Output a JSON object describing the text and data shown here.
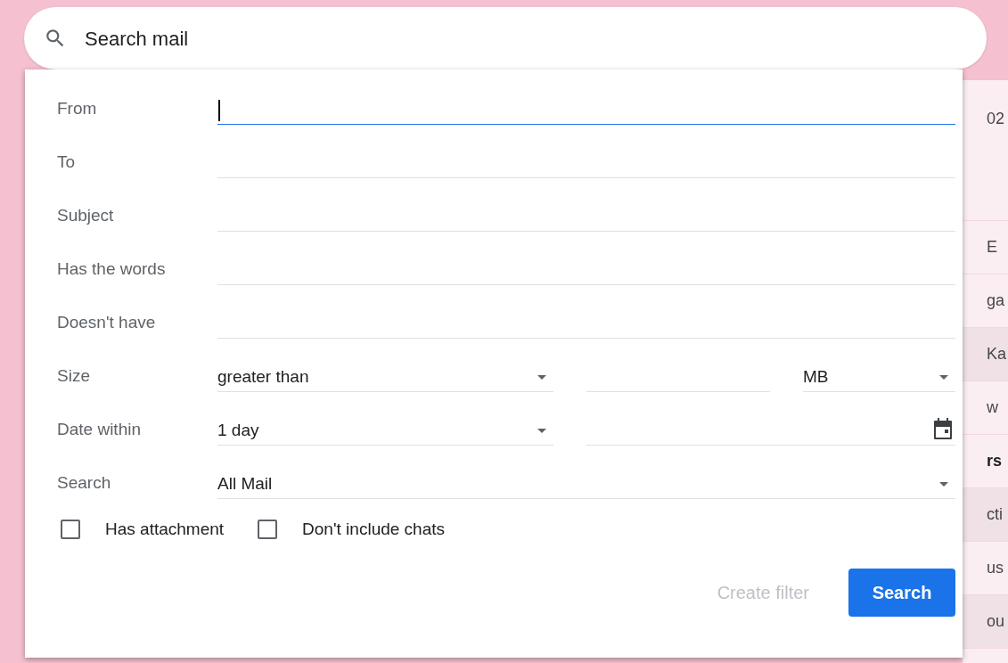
{
  "search_bar": {
    "placeholder": "Search mail"
  },
  "mail_rows": [
    {
      "text": "02",
      "selected": false,
      "unread": false,
      "tall": true
    },
    {
      "text": "E",
      "selected": false,
      "unread": false,
      "tall": false
    },
    {
      "text": "ga",
      "selected": false,
      "unread": false,
      "tall": false
    },
    {
      "text": "Ka",
      "selected": true,
      "unread": false,
      "tall": false
    },
    {
      "text": "w",
      "selected": false,
      "unread": false,
      "tall": false
    },
    {
      "text": "rs",
      "selected": false,
      "unread": true,
      "tall": false
    },
    {
      "text": "cti",
      "selected": true,
      "unread": false,
      "tall": false
    },
    {
      "text": "us",
      "selected": false,
      "unread": false,
      "tall": false
    },
    {
      "text": "ou",
      "selected": true,
      "unread": false,
      "tall": false
    }
  ],
  "fields": [
    {
      "kind": "text",
      "label": "From",
      "focused": true
    },
    {
      "kind": "text",
      "label": "To",
      "focused": false
    },
    {
      "kind": "text",
      "label": "Subject",
      "focused": false
    },
    {
      "kind": "text",
      "label": "Has the words",
      "focused": false
    },
    {
      "kind": "text",
      "label": "Doesn't have",
      "focused": false
    },
    {
      "kind": "size",
      "label": "Size",
      "operator": "greater than",
      "unit": "MB"
    },
    {
      "kind": "date",
      "label": "Date within",
      "range": "1 day"
    },
    {
      "kind": "select",
      "label": "Search",
      "value": "All Mail"
    }
  ],
  "checkboxes": [
    {
      "label": "Has attachment",
      "checked": false
    },
    {
      "label": "Don't include chats",
      "checked": false
    }
  ],
  "create_filter": {
    "label": "Create filter",
    "disabled": true
  },
  "search_button": {
    "label": "Search"
  }
}
